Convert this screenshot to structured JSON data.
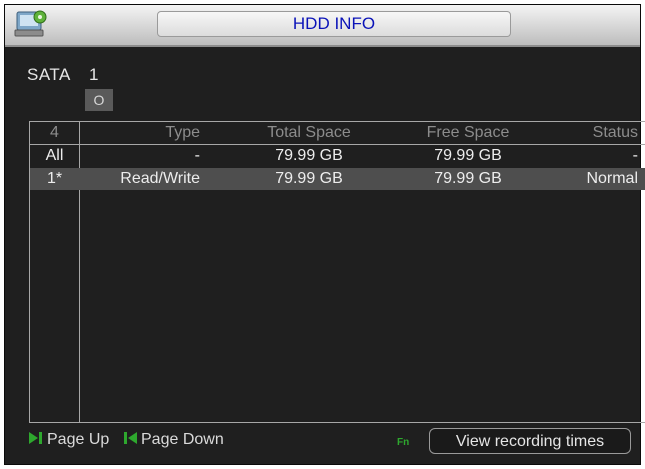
{
  "window": {
    "title": "HDD INFO",
    "icon": "hdd-settings-icon"
  },
  "sata": {
    "label": "SATA",
    "number": "1",
    "disk_status": "O"
  },
  "table": {
    "headers": [
      "4",
      "Type",
      "Total Space",
      "Free Space",
      "Status"
    ],
    "rows": [
      {
        "index": "All",
        "type": "-",
        "total": "79.99 GB",
        "free": "79.99 GB",
        "status": "-"
      },
      {
        "index": "1*",
        "type": "Read/Write",
        "total": "79.99 GB",
        "free": "79.99 GB",
        "status": "Normal"
      }
    ]
  },
  "footer": {
    "page_up_label": "Page Up",
    "page_down_label": "Page Down",
    "page_up_icon": "page-up-icon",
    "page_down_icon": "page-down-icon",
    "fn_label": "Fn",
    "view_button_label": "View recording times"
  },
  "colors": {
    "title_text": "#0a12b8",
    "background": "#1f1f1f",
    "selected_row": "#4e4e4e",
    "nav_icon": "#2ea82e"
  }
}
